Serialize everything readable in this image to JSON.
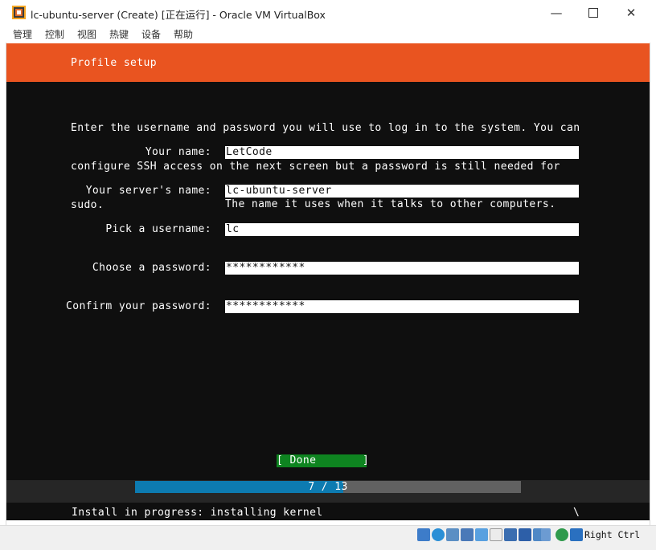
{
  "window": {
    "title": "lc-ubuntu-server (Create) [正在运行] - Oracle VM VirtualBox",
    "minimize_icon": "minimize-icon",
    "maximize_icon": "maximize-icon",
    "close_icon": "close-icon"
  },
  "menu": {
    "items": [
      "管理",
      "控制",
      "视图",
      "热键",
      "设备",
      "帮助"
    ]
  },
  "installer": {
    "header_title": "Profile setup",
    "intro_lines": [
      "Enter the username and password you will use to log in to the system. You can",
      "configure SSH access on the next screen but a password is still needed for",
      "sudo."
    ],
    "fields": {
      "name": {
        "label": "Your name:",
        "value": "LetCode"
      },
      "server": {
        "label": "Your server's name:",
        "value": "lc-ubuntu-server",
        "hint": "The name it uses when it talks to other computers."
      },
      "username": {
        "label": "Pick a username:",
        "value": "lc"
      },
      "password": {
        "label": "Choose a password:",
        "value": "************"
      },
      "confirm": {
        "label": "Confirm your password:",
        "value": "************"
      }
    },
    "done_button": "[ Done       ]",
    "progress": {
      "text": "7 / 13",
      "current": 7,
      "total": 13,
      "fraction": 0.54
    },
    "status": "Install in progress: installing kernel",
    "spinner": "\\"
  },
  "statusbar": {
    "host_key": "Right Ctrl",
    "icons": [
      "hard-disk-icon",
      "optical-drive-icon",
      "audio-icon",
      "network-icon",
      "usb-icon",
      "shared-folder-icon",
      "display-icon",
      "recording-icon",
      "capture-icon",
      "cpu-icon",
      "mouse-integration-icon",
      "keyboard-capture-icon"
    ]
  },
  "colors": {
    "accent_orange": "#e95420",
    "done_green": "#0e8420",
    "progress_blue": "#0d7bb1"
  }
}
